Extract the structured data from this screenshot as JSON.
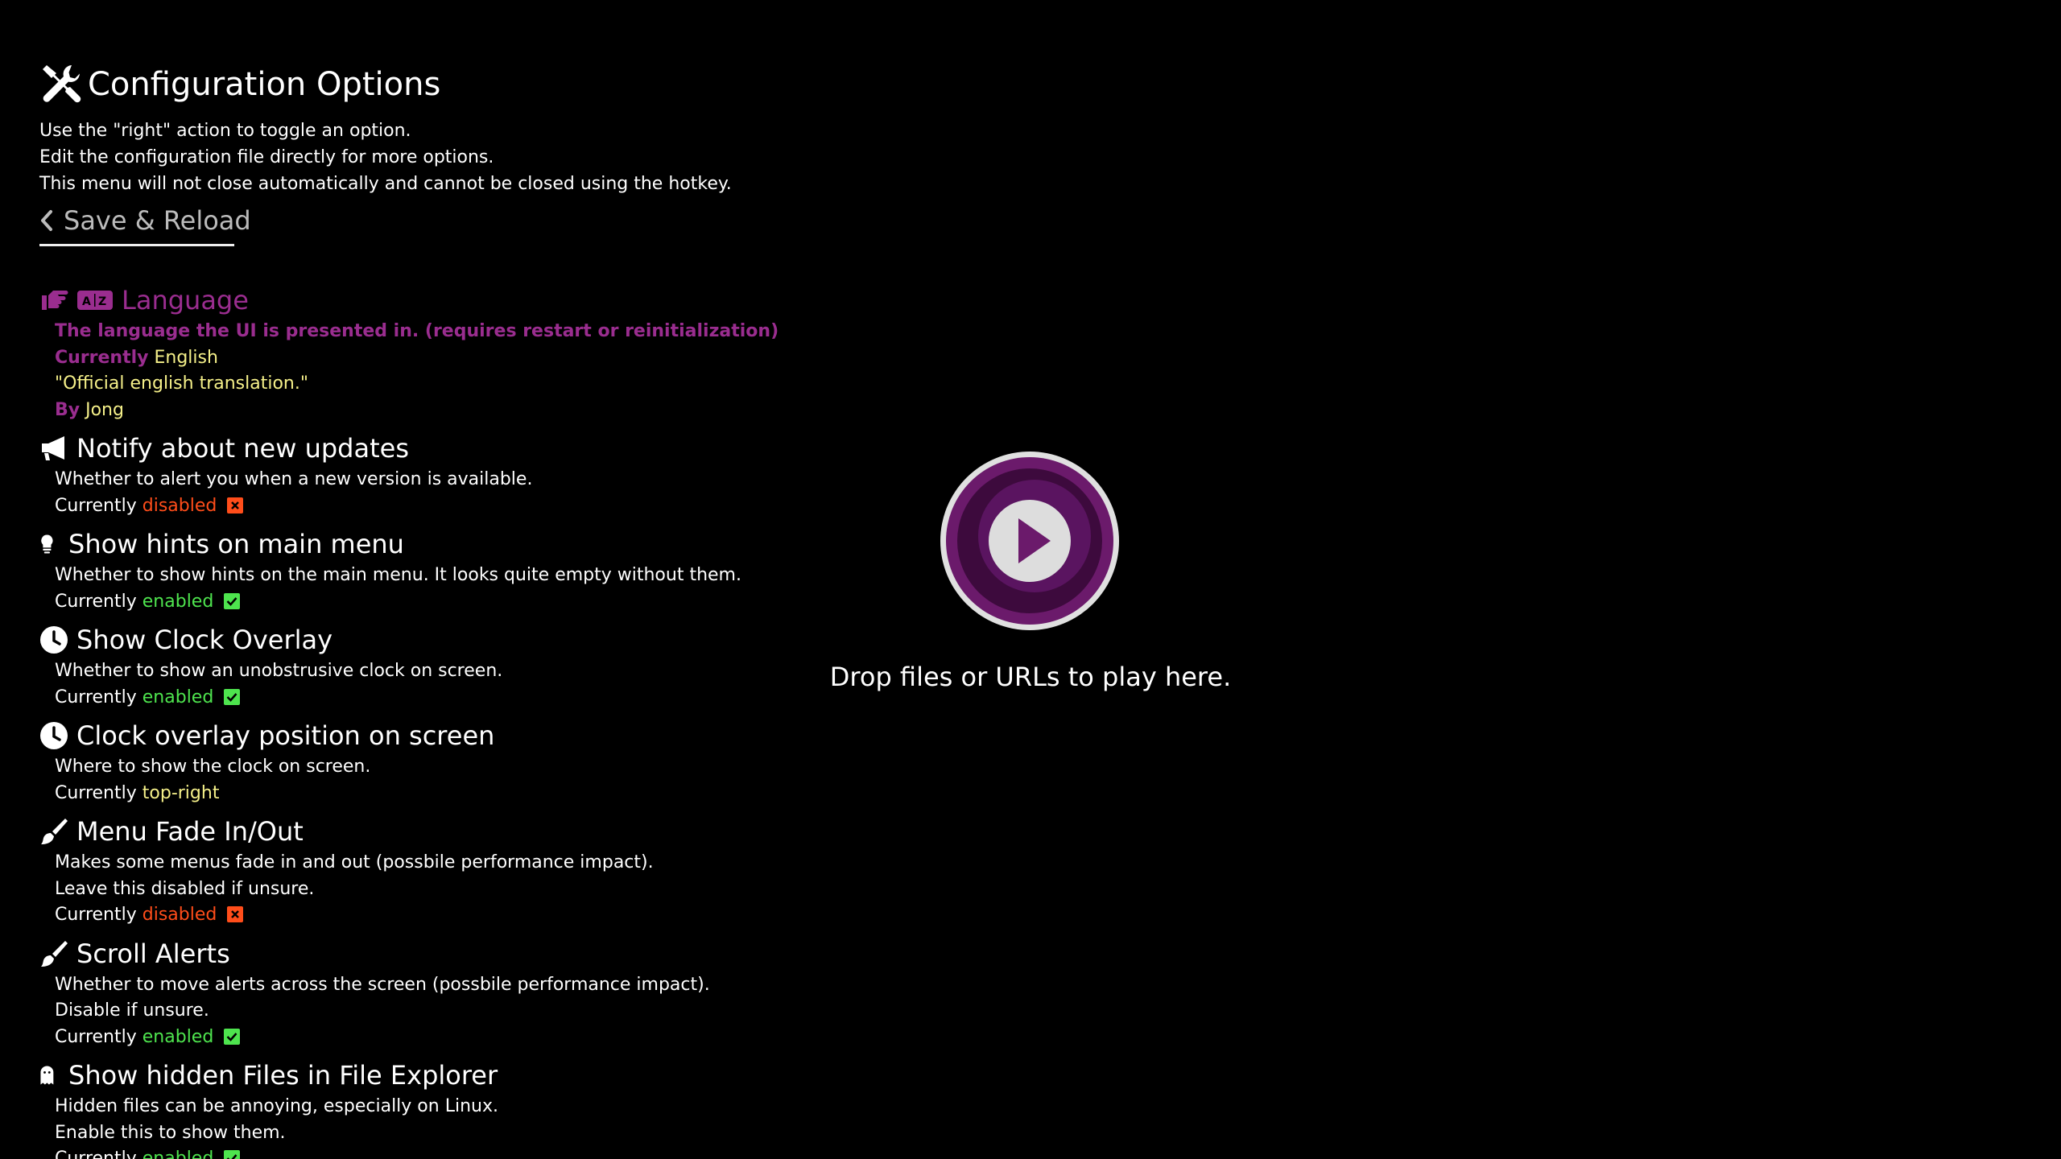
{
  "header": {
    "icon": "tools-icon",
    "title": "Configuration Options",
    "description": [
      "Use the \"right\" action to toggle an option.",
      "Edit the configuration file directly for more options.",
      "This menu will not close automatically and cannot be closed using the hotkey."
    ]
  },
  "back_item": {
    "icon": "chevron-left-icon",
    "label": "Save & Reload"
  },
  "options": {
    "language": {
      "icons": [
        "pointing-hand-icon",
        "translate-icon"
      ],
      "title": "Language",
      "description": "The language the UI is presented in. (requires restart or reinitialization)",
      "currently_label": "Currently",
      "value": "English",
      "quote": "\"Official english translation.\"",
      "by_label": "By",
      "author": "Jong"
    },
    "notify_updates": {
      "icon": "megaphone-icon",
      "title": "Notify about new updates",
      "description": [
        "Whether to alert you when a new version is available."
      ],
      "currently_label": "Currently",
      "value": "disabled"
    },
    "show_hints": {
      "icon": "lightbulb-icon",
      "title": "Show hints on main menu",
      "description": [
        "Whether to show hints on the main menu. It looks quite empty without them."
      ],
      "currently_label": "Currently",
      "value": "enabled"
    },
    "clock_overlay": {
      "icon": "clock-icon",
      "title": "Show Clock Overlay",
      "description": [
        "Whether to show an unobstrusive clock on screen."
      ],
      "currently_label": "Currently",
      "value": "enabled"
    },
    "clock_position": {
      "icon": "clock-icon",
      "title": "Clock overlay position on screen",
      "description": [
        "Where to show the clock on screen."
      ],
      "currently_label": "Currently",
      "value": "top-right"
    },
    "menu_fade": {
      "icon": "paintbrush-icon",
      "title": "Menu Fade In/Out",
      "description": [
        "Makes some menus fade in and out (possbile performance impact).",
        "Leave this disabled if unsure."
      ],
      "currently_label": "Currently",
      "value": "disabled"
    },
    "scroll_alerts": {
      "icon": "paintbrush-icon",
      "title": "Scroll Alerts",
      "description": [
        "Whether to move alerts across the screen (possbile performance impact).",
        "Disable if unsure."
      ],
      "currently_label": "Currently",
      "value": "enabled"
    },
    "hidden_files": {
      "icon": "ghost-icon",
      "title": "Show hidden Files in File Explorer",
      "description": [
        "Hidden files can be annoying, especially on Linux.",
        "Enable this to show them."
      ],
      "currently_label": "Currently",
      "value": "enabled"
    }
  },
  "player": {
    "icon": "play-logo-icon",
    "drop_text": "Drop files or URLs to play here."
  },
  "colors": {
    "selected": "#9a2d8f",
    "value_text": "#f5f089",
    "enabled": "#4ee44e",
    "disabled": "#ff4d1a",
    "logo_outer": "#6b1a6b",
    "logo_inner": "#3d0a3d"
  }
}
